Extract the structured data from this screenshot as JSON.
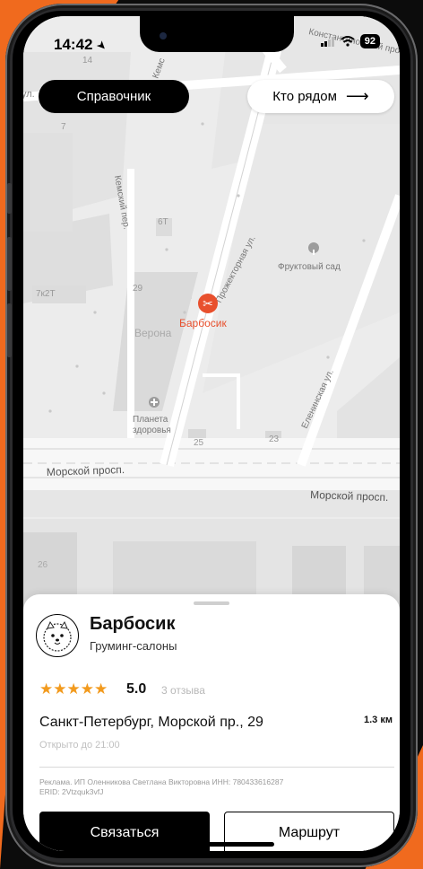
{
  "status_bar": {
    "time": "14:42",
    "battery": "92"
  },
  "top_buttons": {
    "reference": "Справочник",
    "nearby": "Кто рядом",
    "nearby_arrow": "⟶"
  },
  "map_labels": {
    "house_14": "14",
    "street_kemsky_per": "Кемский пер.",
    "street_kemskaya_top": "Кемс",
    "street_konstantinovsky": "Константиновский просп.",
    "street_ul_left": "ул.",
    "house_7": "7",
    "house_6t": "6Т",
    "house_7k2t": "7к2Т",
    "house_29": "29",
    "verona": "Верона",
    "street_proektornaya": "Прожекторная ул.",
    "fruit_garden": "Фруктовый сад",
    "poi_name": "Барбосик",
    "planeta_zdorovya": "Планета здоровья",
    "house_25": "25",
    "house_23": "23",
    "street_eleninskaya": "Еленинская ул.",
    "morskoy_left": "Морской просп.",
    "morskoy_right": "Морской просп.",
    "house_26": "26"
  },
  "place": {
    "name": "Барбосик",
    "category": "Груминг-салоны",
    "stars": "★★★★★",
    "rating": "5.0",
    "reviews": "3 отзыва",
    "address": "Санкт-Петербург, Морской пр., 29",
    "distance": "1.3 км",
    "open_until": "Открыто до 21:00",
    "ad_line1": "Реклама. ИП Оленникова Светлана Викторовна ИНН: 780433616287",
    "ad_line2": "ERID: 2Vtzquk3vfJ"
  },
  "actions": {
    "contact": "Связаться",
    "route": "Маршрут"
  },
  "colors": {
    "brand_orange": "#f06a1e",
    "poi_red": "#e8502d",
    "star": "#f29a1d"
  },
  "icons": [
    "location-arrow-icon",
    "signal-icon",
    "wifi-icon",
    "battery-icon",
    "scissors-icon",
    "tree-icon",
    "pharmacy-icon",
    "dog-avatar-icon",
    "arrow-right-icon"
  ]
}
